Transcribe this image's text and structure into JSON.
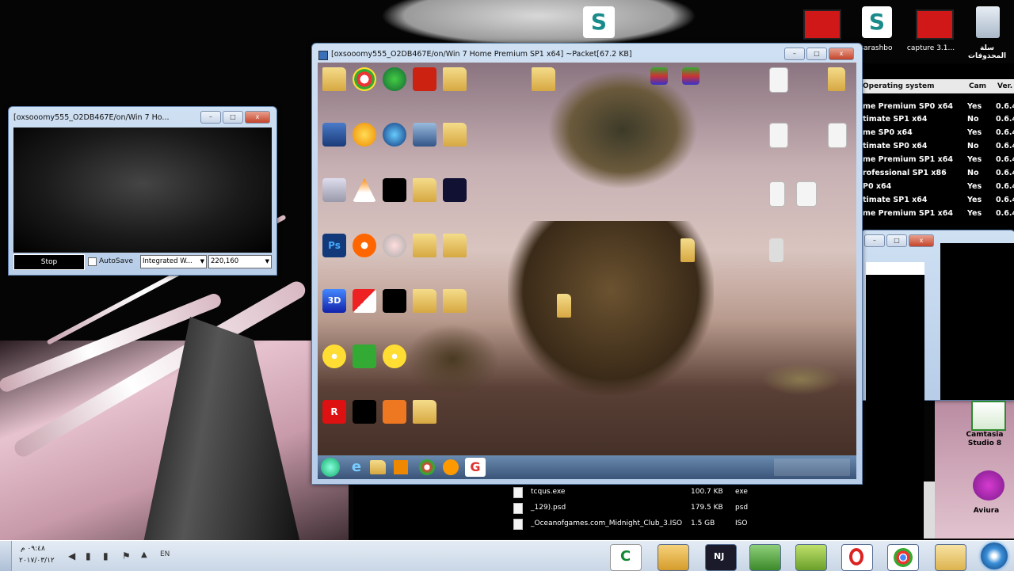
{
  "small_window": {
    "title": "[oxsooomy555_O2DB467E/on/Win 7 Ho...",
    "stop_label": "Stop",
    "autosave_label": "AutoSave",
    "source_value": "Integrated W...",
    "resolution_value": "220,160"
  },
  "main_window": {
    "title": "[oxsooomy555_O2DB467E/on/Win 7 Home Premium SP1 x64] ~Packet[67.2 KB]"
  },
  "right_table": {
    "headers": [
      "Operating system",
      "Cam",
      "Ver."
    ],
    "rows": [
      [
        "me Premium SP0 x64",
        "Yes",
        "0.6.4"
      ],
      [
        "timate SP1 x64",
        "No",
        "0.6.4"
      ],
      [
        "me SP0 x64",
        "Yes",
        "0.6.4"
      ],
      [
        "timate SP0 x64",
        "No",
        "0.6.4"
      ],
      [
        "me Premium SP1 x64",
        "Yes",
        "0.6.4"
      ],
      [
        "rofessional SP1 x86",
        "No",
        "0.6.4"
      ],
      [
        "P0 x64",
        "Yes",
        "0.6.4"
      ],
      [
        "timate SP1 x64",
        "Yes",
        "0.6.4"
      ],
      [
        "me Premium SP1 x64",
        "Yes",
        "0.6.4"
      ]
    ]
  },
  "file_list": {
    "rows": [
      {
        "name": "tcqus.exe",
        "size": "100.7 KB",
        "type": "exe"
      },
      {
        "name": "_129).psd",
        "size": "179.5 KB",
        "type": "psd"
      },
      {
        "name": "_Oceanofgames.com_Midnight_Club_3.ISO",
        "size": "1.5 GB",
        "type": "ISO"
      }
    ]
  },
  "desktop_top_labels": [
    "سلة المحذوفات",
    "capture 3.1...",
    "sarashbo"
  ],
  "right_icon_label": "Camtasia Studio 8",
  "right_icon_label2": "Aviura",
  "taskbar": {
    "time": "٠٩:٤٨ م",
    "date": "٢٠١٧/٠٣/١٢",
    "lang": "EN",
    "apps": [
      "camtasia-icon",
      "avatar-icon",
      "nj-icon",
      "green-app-icon",
      "sync-icon",
      "opera-icon",
      "chrome-icon",
      "explorer-icon",
      "windows-start-icon"
    ]
  },
  "colors": {
    "accent_blue": "#b7cde8",
    "taskbar": "#d9e3ef",
    "wallpaper_pink": "#e3b9c6"
  }
}
